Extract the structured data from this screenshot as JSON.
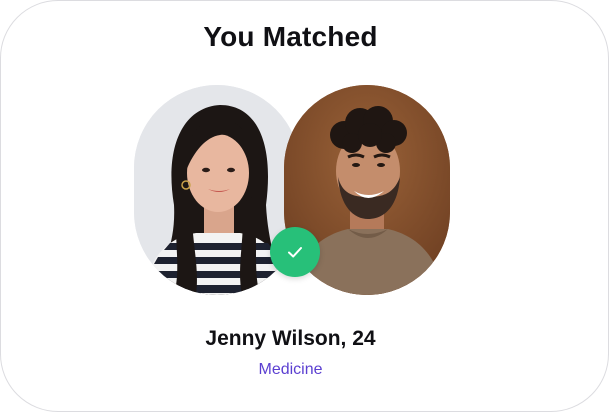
{
  "header": {
    "title": "You Matched"
  },
  "match": {
    "name_age": "Jenny Wilson, 24",
    "profession": "Medicine",
    "status": "matched"
  },
  "icons": {
    "match_badge": "check-icon"
  },
  "colors": {
    "badge": "#27c079",
    "profession": "#5b3fd1",
    "text": "#101014"
  }
}
